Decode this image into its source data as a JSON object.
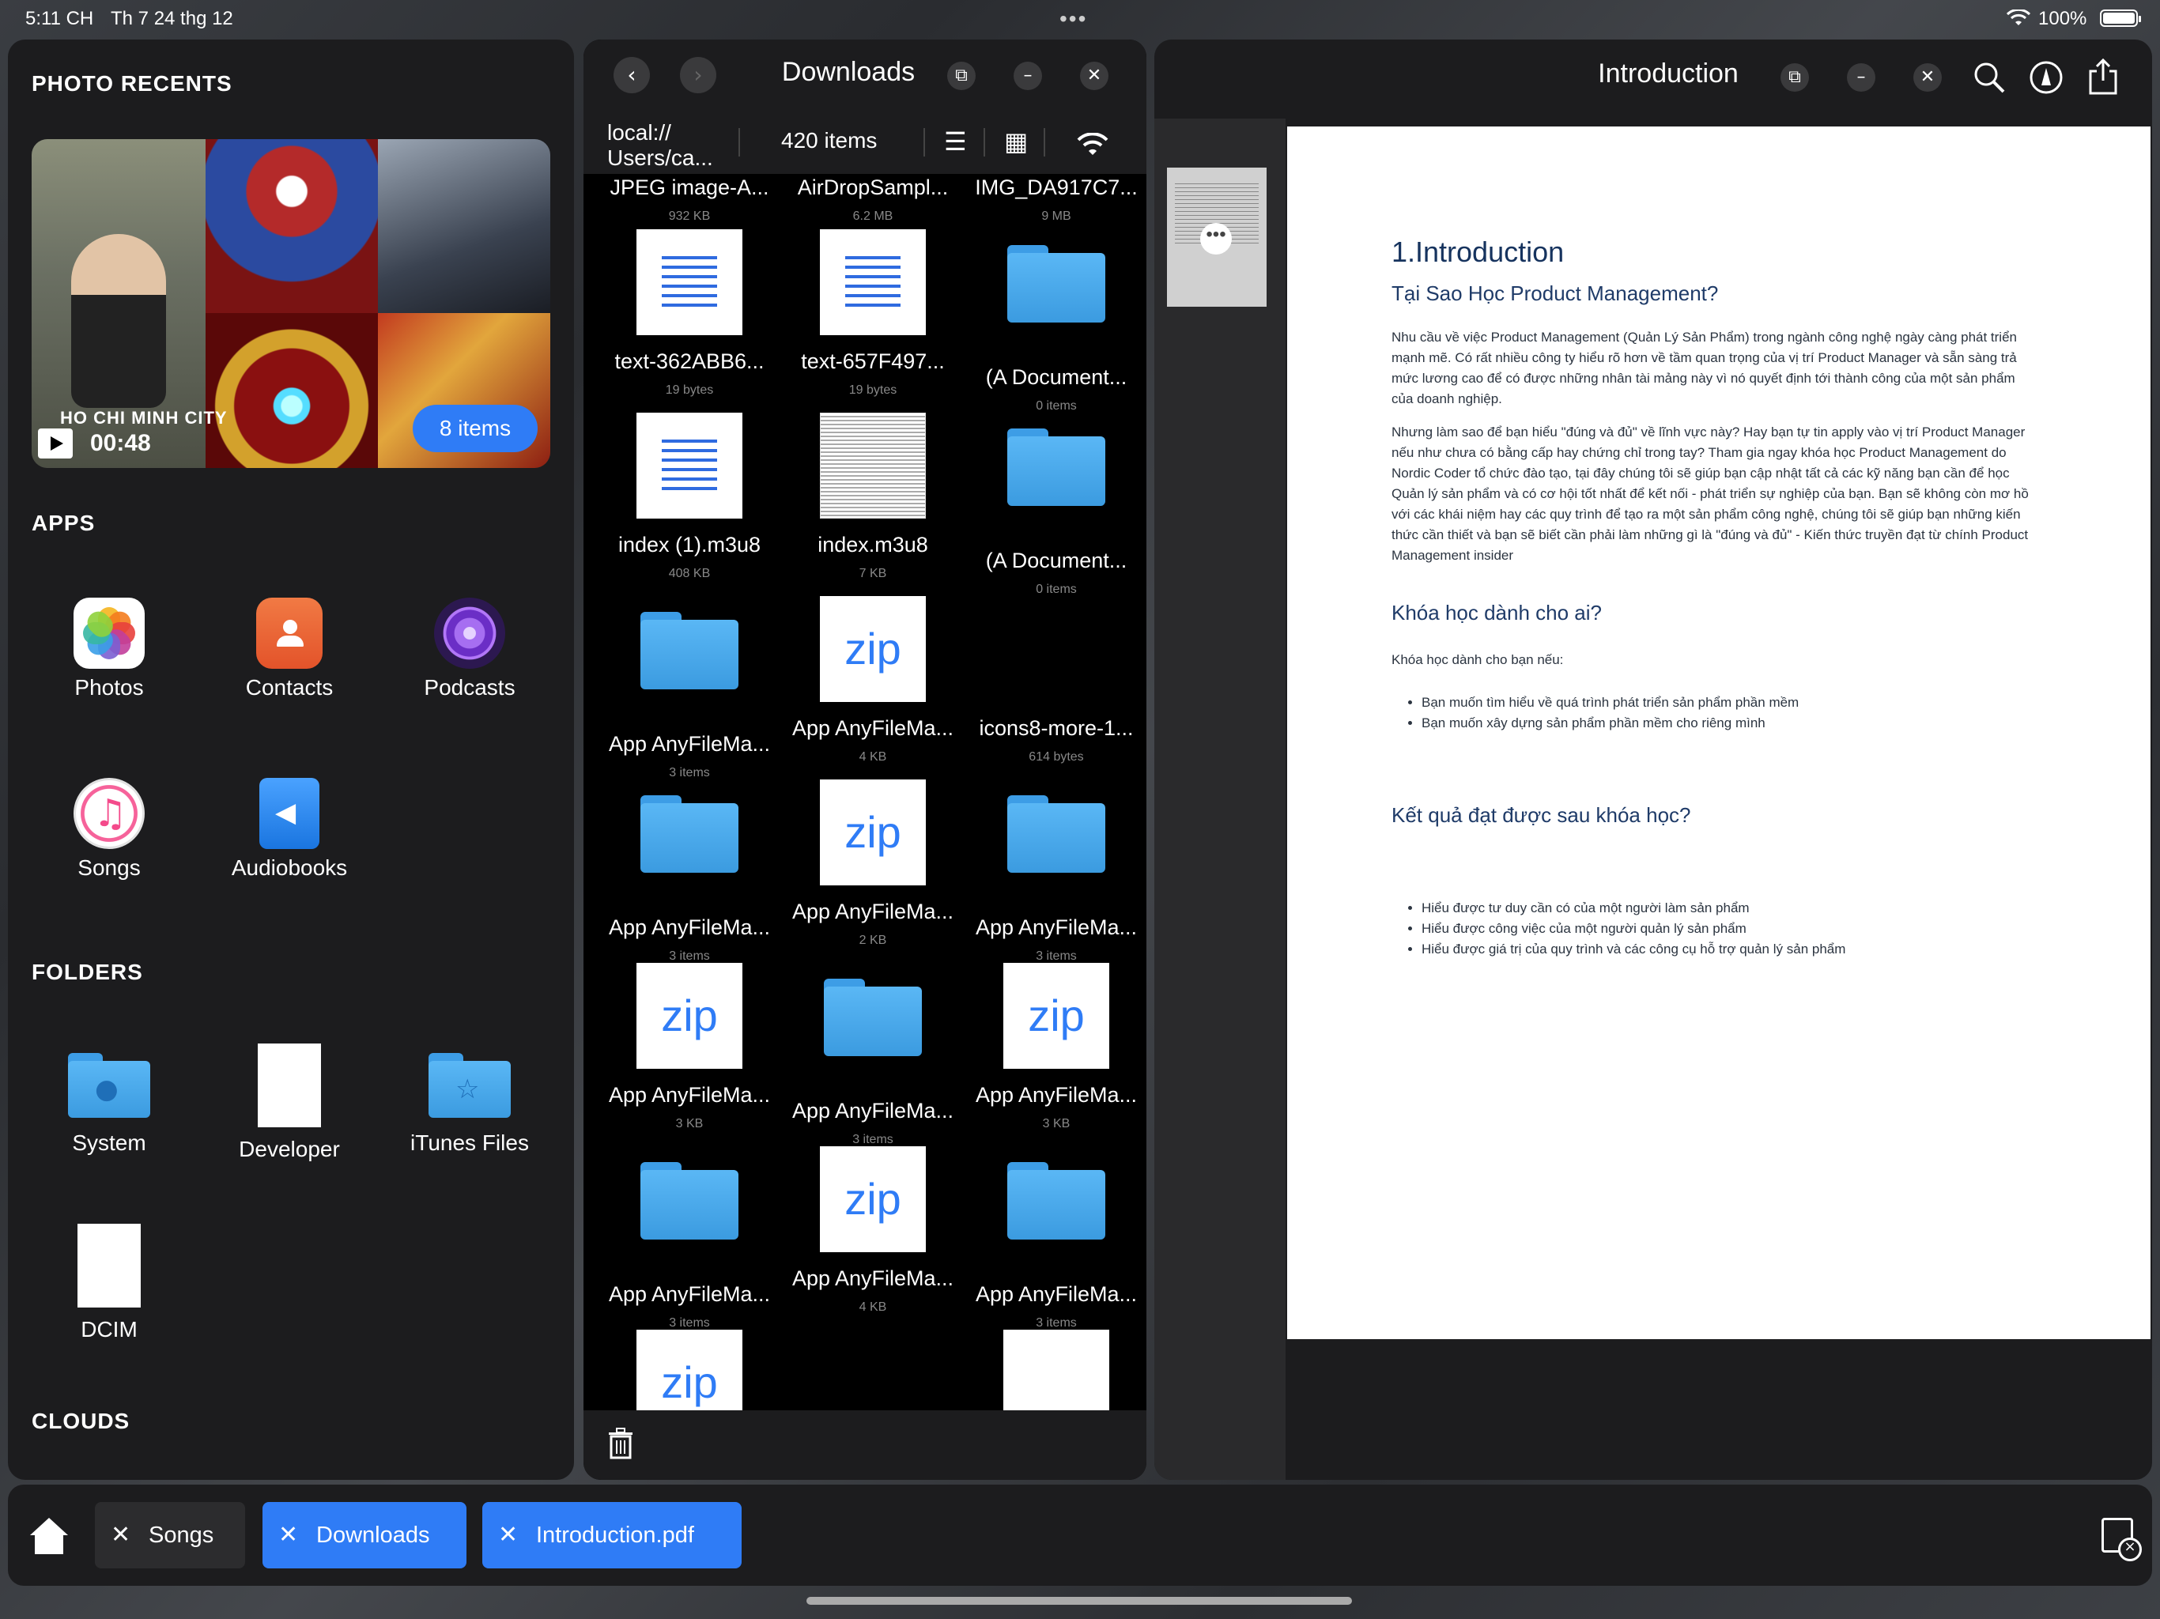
{
  "status": {
    "time": "5:11 CH",
    "date": "Th 7 24 thg 12",
    "battery": "100%"
  },
  "left": {
    "photo_recents_title": "PHOTO RECENTS",
    "recent": {
      "city_text": "HO CHI MINH CITY",
      "duration": "00:48",
      "items_label": "8 items"
    },
    "apps_title": "APPS",
    "apps": [
      {
        "label": "Photos",
        "icon": "photos-icon"
      },
      {
        "label": "Contacts",
        "icon": "contacts-icon"
      },
      {
        "label": "Podcasts",
        "icon": "podcasts-icon"
      },
      {
        "label": "Songs",
        "icon": "music-icon"
      },
      {
        "label": "Audiobooks",
        "icon": "audiobook-icon"
      }
    ],
    "folders_title": "FOLDERS",
    "folders": [
      {
        "label": "System",
        "icon": "apple-folder-icon"
      },
      {
        "label": "Developer",
        "icon": "document-icon"
      },
      {
        "label": "iTunes Files",
        "icon": "star-folder-icon"
      },
      {
        "label": "DCIM",
        "icon": "document-icon"
      }
    ],
    "clouds_title": "CLOUDS"
  },
  "downloads": {
    "title": "Downloads",
    "path": [
      "local://",
      "Users/ca..."
    ],
    "item_count": "420 items",
    "files": [
      {
        "name": "JPEG image-A...",
        "meta": "932 KB",
        "kind": "none"
      },
      {
        "name": "AirDropSampl...",
        "meta": "6.2 MB",
        "kind": "none"
      },
      {
        "name": "IMG_DA917C7...",
        "meta": "9 MB",
        "kind": "none"
      },
      {
        "name": "text-362ABB6...",
        "meta": "19 bytes",
        "kind": "textdoc"
      },
      {
        "name": "text-657F497...",
        "meta": "19 bytes",
        "kind": "textdoc"
      },
      {
        "name": "(A Document...",
        "meta": "0 items",
        "kind": "folder"
      },
      {
        "name": "index (1).m3u8",
        "meta": "408 KB",
        "kind": "textdoc"
      },
      {
        "name": "index.m3u8",
        "meta": "7 KB",
        "kind": "scan"
      },
      {
        "name": "(A Document...",
        "meta": "0 items",
        "kind": "folder"
      },
      {
        "name": "App AnyFileMa...",
        "meta": "3 items",
        "kind": "folder"
      },
      {
        "name": "App AnyFileMa...",
        "meta": "4 KB",
        "kind": "zip"
      },
      {
        "name": "icons8-more-1...",
        "meta": "614 bytes",
        "kind": "none"
      },
      {
        "name": "App AnyFileMa...",
        "meta": "3 items",
        "kind": "folder"
      },
      {
        "name": "App AnyFileMa...",
        "meta": "2 KB",
        "kind": "zip"
      },
      {
        "name": "App AnyFileMa...",
        "meta": "3 items",
        "kind": "folder"
      },
      {
        "name": "App AnyFileMa...",
        "meta": "3 KB",
        "kind": "zip"
      },
      {
        "name": "App AnyFileMa...",
        "meta": "3 items",
        "kind": "folder"
      },
      {
        "name": "App AnyFileMa...",
        "meta": "3 KB",
        "kind": "zip"
      },
      {
        "name": "App AnyFileMa...",
        "meta": "3 items",
        "kind": "folder"
      },
      {
        "name": "App AnyFileMa...",
        "meta": "4 KB",
        "kind": "zip"
      },
      {
        "name": "App AnyFileMa...",
        "meta": "3 items",
        "kind": "folder"
      }
    ],
    "zip_label": "zip"
  },
  "pdf": {
    "title": "Introduction",
    "heading": "1.Introduction",
    "subheading": "Tại Sao Học Product Management?",
    "para1": "Nhu cầu về việc Product Management (Quản Lý Sản Phẩm) trong ngành công nghệ ngày càng phát triển mạnh mẽ. Có rất nhiều công ty hiểu rõ hơn về tầm quan trọng của vị trí Product Manager và sẵn sàng trả mức lương cao để có được những nhân tài mảng này vì nó quyết định tới thành công của một sản phẩm của doanh nghiệp.",
    "para2": "Nhưng làm sao để bạn hiểu \"đúng và đủ\" về lĩnh vực này? Hay bạn tự tin apply vào vị trí Product Manager nếu như chưa có bằng cấp hay chứng chỉ trong tay? Tham gia ngay khóa học Product Management do Nordic Coder tổ chức đào tạo, tại đây chúng tôi sẽ giúp bạn cập nhật tất cả các kỹ năng bạn cần để học Quản lý sản phẩm và có cơ hội tốt nhất để kết nối - phát triển sự nghiệp của bạn. Bạn sẽ không còn mơ hồ với các khái niệm hay các quy trình để tạo ra một sản phẩm công nghệ, chúng tôi sẽ giúp bạn những kiến thức cần thiết và bạn sẽ biết cần phải làm những gì là \"đúng và đủ\" - Kiến thức truyền đạt từ chính Product Management insider",
    "h_audience": "Khóa học dành cho ai?",
    "audience_intro": "Khóa học dành cho bạn nếu:",
    "audience_list": [
      "Bạn muốn tìm hiểu về quá trình phát triển sản phẩm phần mềm",
      "Bạn muốn xây dựng sản phẩm phần mềm cho riêng mình"
    ],
    "h_outcome": "Kết quả đạt được sau khóa học?",
    "outcome_list": [
      "Hiểu được tư duy cần có của một người làm sản phẩm",
      "Hiểu được công việc của một người quản lý sản phẩm",
      "Hiểu được giá trị của quy trình và các công cụ hỗ trợ quản lý sản phẩm"
    ]
  },
  "tabs": [
    {
      "label": "Songs",
      "active": false
    },
    {
      "label": "Downloads",
      "active": true
    },
    {
      "label": "Introduction.pdf",
      "active": true
    }
  ]
}
